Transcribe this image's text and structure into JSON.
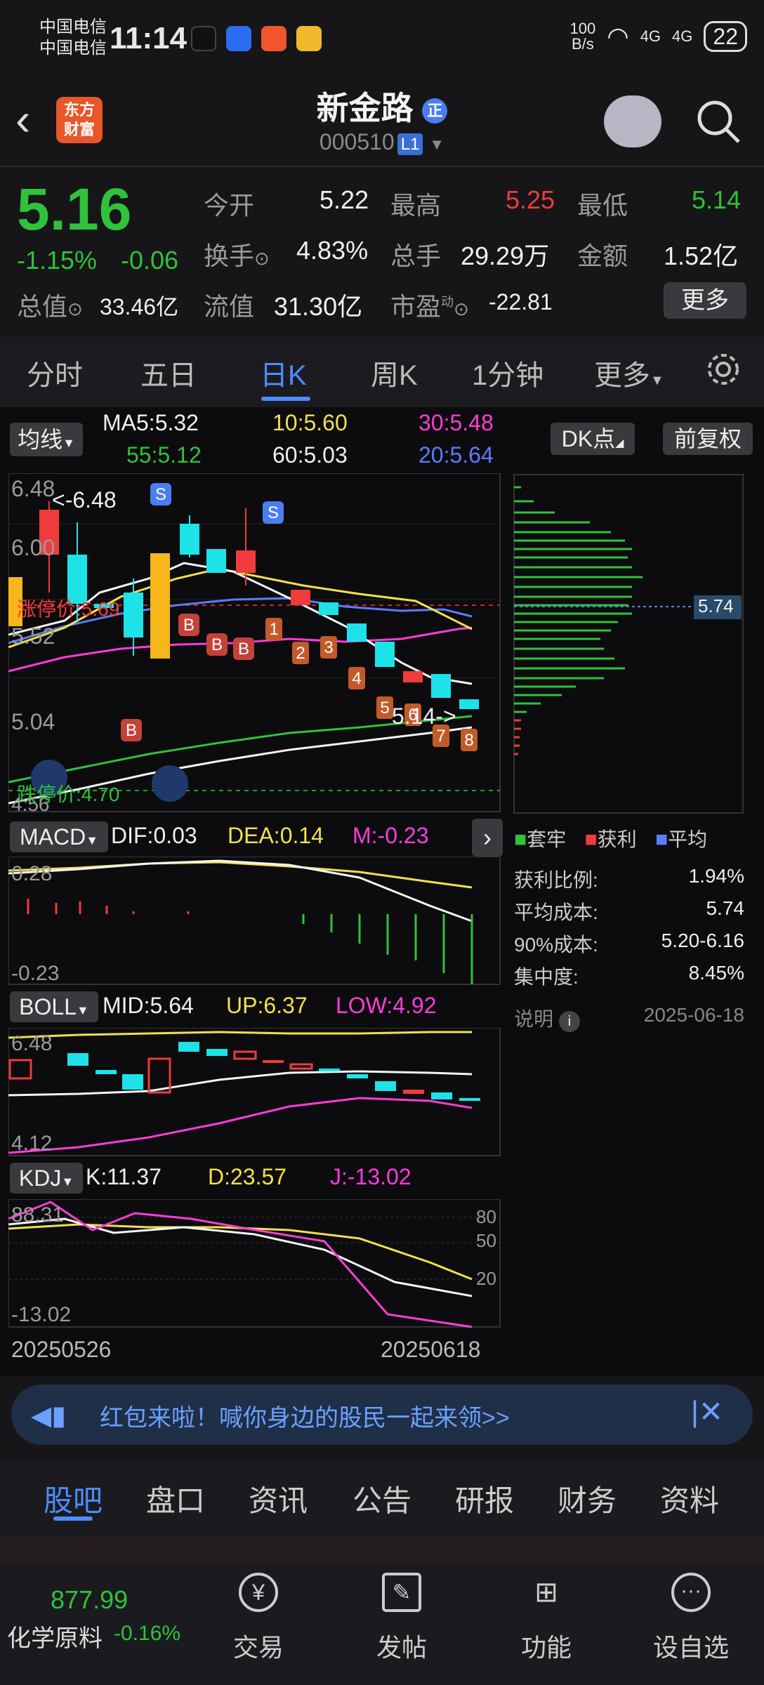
{
  "status_bar": {
    "carrier1": "中国电信",
    "carrier2": "中国电信",
    "time": "11:14",
    "net_speed_top": "100",
    "net_speed_bottom": "B/s",
    "signal1": "4G",
    "signal2": "4G",
    "battery": "22"
  },
  "header": {
    "logo_line1": "东方",
    "logo_line2": "财富",
    "title": "新金路",
    "badge": "正",
    "code": "000510",
    "level": "L1"
  },
  "quote": {
    "price": "5.16",
    "change_pct": "-1.15%",
    "change": "-0.06",
    "open_label": "今开",
    "open": "5.22",
    "high_label": "最高",
    "high": "5.25",
    "low_label": "最低",
    "low": "5.14",
    "turnover_label": "换手",
    "turnover": "4.83%",
    "volume_label": "总手",
    "volume": "29.29万",
    "amount_label": "金额",
    "amount": "1.52亿",
    "mktcap_label": "总值",
    "mktcap": "33.46亿",
    "float_label": "流值",
    "float": "31.30亿",
    "pe_label": "市盈",
    "pe_tag": "动",
    "pe": "-22.81",
    "more": "更多"
  },
  "tabs": [
    "分时",
    "五日",
    "日K",
    "周K",
    "1分钟",
    "更多"
  ],
  "ma_legend": {
    "btn": "均线",
    "ma5": "MA5:5.32",
    "ma10": "10:5.60",
    "ma30": "30:5.48",
    "ma55": "55:5.12",
    "ma60": "60:5.03",
    "ma20": "20:5.64",
    "dk": "DK点",
    "adj": "前复权"
  },
  "kline": {
    "y_top": "6.48",
    "y_2": "6.00",
    "y_3": "5.52",
    "y_4": "5.04",
    "y_bottom": "4.56",
    "max_label": "<-6.48",
    "min_label": "5.14->",
    "limit_up": "涨停价:5.69",
    "limit_down": "跌停价:4.70",
    "chip_price": "5.74"
  },
  "chips": {
    "legend_firm": "套牢",
    "legend_profit": "获利",
    "legend_avg": "平均",
    "profit_ratio_label": "获利比例:",
    "profit_ratio": "1.94%",
    "avg_cost_label": "平均成本:",
    "avg_cost": "5.74",
    "cost90_label": "90%成本:",
    "cost90": "5.20-6.16",
    "concentration_label": "集中度:",
    "concentration": "8.45%",
    "note_label": "说明",
    "date": "2025-06-18"
  },
  "macd": {
    "name": "MACD",
    "dif": "DIF:0.03",
    "dea": "DEA:0.14",
    "m": "M:-0.23",
    "y_top": "0.28",
    "y_bottom": "-0.23"
  },
  "boll": {
    "name": "BOLL",
    "mid": "MID:5.64",
    "up": "UP:6.37",
    "low": "LOW:4.92",
    "y_top": "6.48",
    "y_bottom": "4.12"
  },
  "kdj": {
    "name": "KDJ",
    "k": "K:11.37",
    "d": "D:23.57",
    "j": "J:-13.02",
    "y_top": "88.31",
    "y_bottom": "-13.02",
    "r80": "80",
    "r50": "50",
    "r20": "20"
  },
  "dates": {
    "start": "20250526",
    "end": "20250618"
  },
  "banner": {
    "text": "红包来啦！喊你身边的股民一起来领>>"
  },
  "bottom_tabs": [
    "股吧",
    "盘口",
    "资讯",
    "公告",
    "研报",
    "财务",
    "资料"
  ],
  "nav": {
    "index_value": "877.99",
    "index_name": "化学原料",
    "index_change": "-0.16%",
    "trade": "交易",
    "post": "发帖",
    "func": "功能",
    "watch": "设自选"
  }
}
